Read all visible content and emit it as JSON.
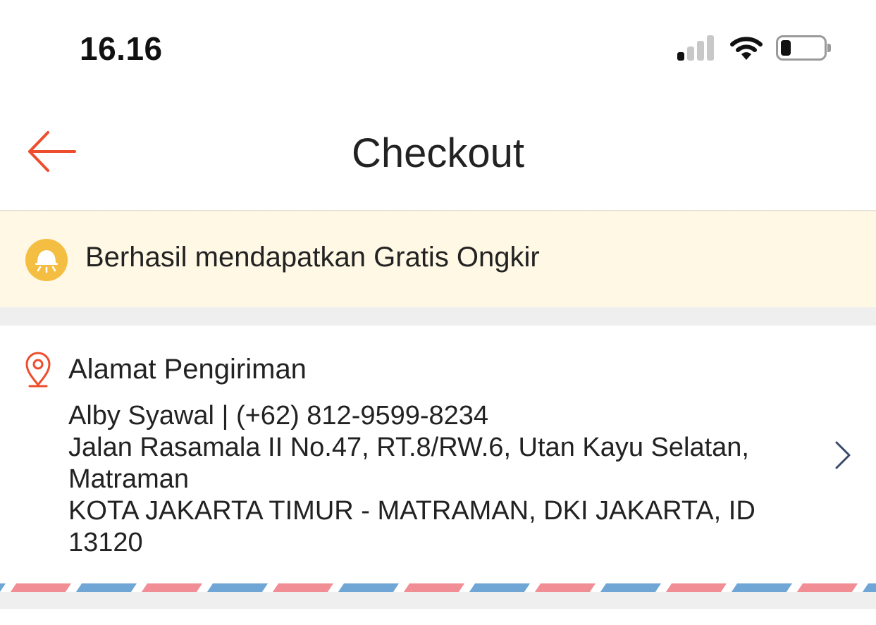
{
  "status_bar": {
    "time": "16.16",
    "icons": [
      "signal-icon",
      "wifi-icon",
      "battery-icon"
    ]
  },
  "header": {
    "title": "Checkout",
    "back_icon": "arrow-left-icon"
  },
  "notice": {
    "icon": "bell-icon",
    "text": "Berhasil mendapatkan Gratis Ongkir"
  },
  "address": {
    "icon": "location-pin-icon",
    "heading": "Alamat Pengiriman",
    "recipient": "Alby Syawal | (+62) 812-9599-8234",
    "street_line1": "Jalan Rasamala II No.47, RT.8/RW.6, Utan Kayu Selatan,",
    "street_line2": "Matraman",
    "city_line1": "KOTA JAKARTA TIMUR - MATRAMAN, DKI JAKARTA, ID",
    "city_line2": "13120",
    "chevron_icon": "chevron-right-icon"
  },
  "colors": {
    "accent": "#ee4d2d",
    "notice_bg": "#fff8e4",
    "bell_bg": "#f4be42",
    "stripe_red": "#f18d95",
    "stripe_blue": "#6fa6d6",
    "separator": "#efefef"
  }
}
